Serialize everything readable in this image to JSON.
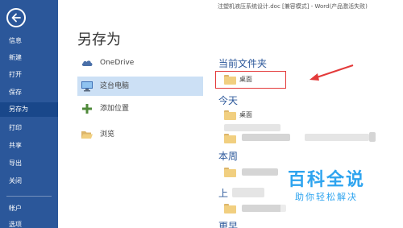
{
  "window": {
    "title": "注塑机液压系统设计.doc [兼容模式] - Word(产品激活失败)"
  },
  "sidebar": {
    "back_icon": "back-arrow-icon",
    "items": [
      {
        "label": "信息"
      },
      {
        "label": "新建"
      },
      {
        "label": "打开"
      },
      {
        "label": "保存"
      },
      {
        "label": "另存为"
      },
      {
        "label": "打印"
      },
      {
        "label": "共享"
      },
      {
        "label": "导出"
      },
      {
        "label": "关闭"
      },
      {
        "label": "帐户"
      },
      {
        "label": "选项"
      }
    ],
    "active_index": 4
  },
  "page": {
    "title": "另存为"
  },
  "locations": [
    {
      "label": "OneDrive",
      "icon": "cloud-icon"
    },
    {
      "label": "这台电脑",
      "icon": "computer-icon"
    },
    {
      "label": "添加位置",
      "icon": "plus-icon"
    },
    {
      "label": "浏览",
      "icon": "folder-open-icon"
    }
  ],
  "recent": {
    "current_folder_heading": "当前文件夹",
    "current_folder_name": "桌面",
    "today_heading": "今天",
    "today_folder_name": "桌面",
    "this_week_heading": "本周",
    "last_week_heading": "上",
    "older_heading": "更早"
  },
  "watermark": {
    "title": "百科全说",
    "subtitle": "助你轻松解决"
  },
  "colors": {
    "sidebar": "#2b579a",
    "sidebar_active": "#19478a",
    "accent": "#2b579a",
    "selected_location": "#cce0f5",
    "annotation_red": "#e33a3a",
    "watermark_blue": "#2ea4ef",
    "folder": "#f1cf80"
  }
}
